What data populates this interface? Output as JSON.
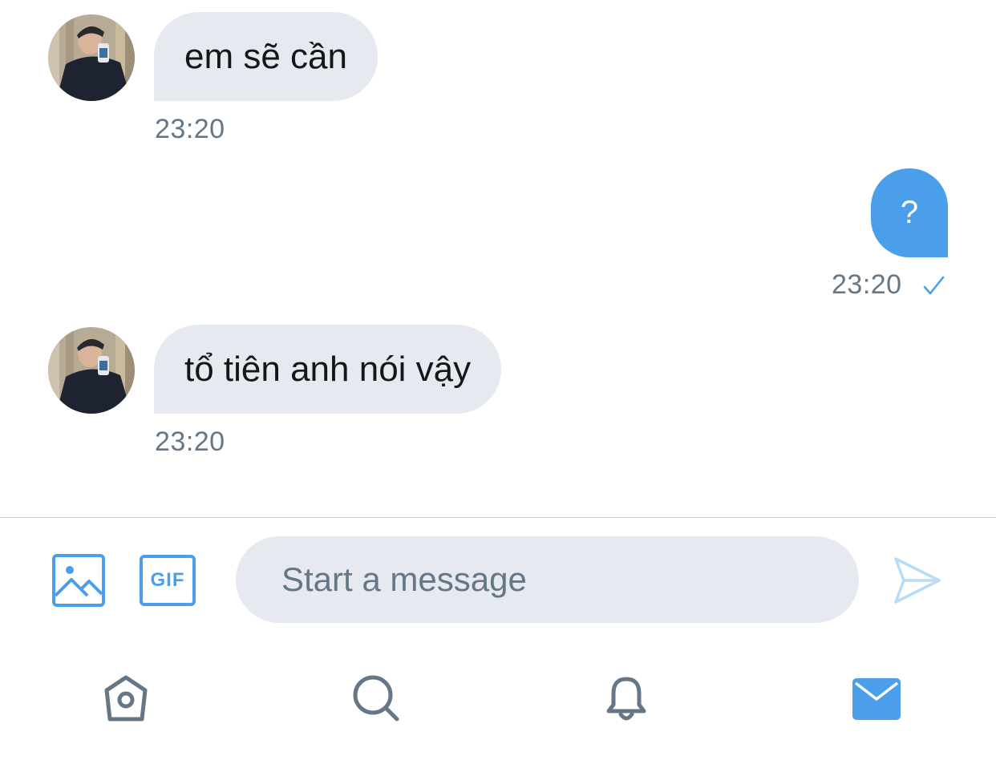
{
  "colors": {
    "accent": "#4a9eea",
    "bubble_incoming": "#e6e9ef",
    "meta_text": "#657786",
    "nav_icon": "#657786"
  },
  "messages": [
    {
      "direction": "incoming",
      "text": "em sẽ cần",
      "time": "23:20"
    },
    {
      "direction": "outgoing",
      "text": "?",
      "time": "23:20",
      "status_icon": "checkmark-icon"
    },
    {
      "direction": "incoming",
      "text": "tổ tiên anh nói vậy",
      "time": "23:20"
    }
  ],
  "composer": {
    "placeholder": "Start a message",
    "value": "",
    "media_icon": "image-icon",
    "gif_label": "GIF",
    "send_icon": "send-icon"
  },
  "tabbar": {
    "items": [
      {
        "icon": "home-icon",
        "active": false
      },
      {
        "icon": "search-icon",
        "active": false
      },
      {
        "icon": "bell-icon",
        "active": false
      },
      {
        "icon": "mail-icon",
        "active": true
      }
    ]
  }
}
